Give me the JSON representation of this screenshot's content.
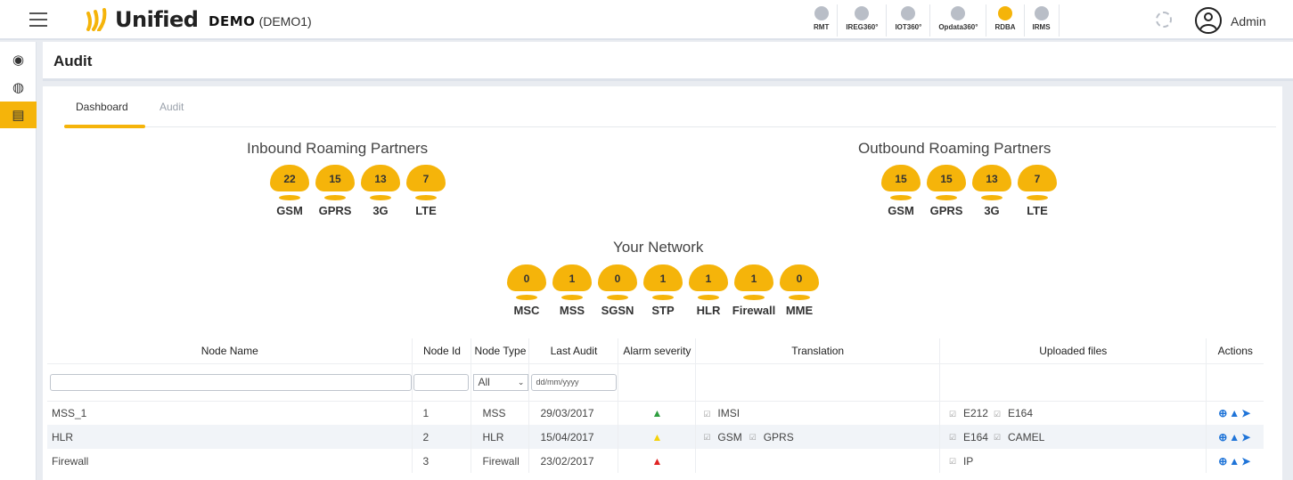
{
  "header": {
    "brand": "Unified",
    "demo_bold": "DEMO",
    "demo_code": "(DEMO1)",
    "apps": [
      {
        "label": "RMT",
        "active": false
      },
      {
        "label": "IREG360°",
        "active": false
      },
      {
        "label": "IOT360°",
        "active": false
      },
      {
        "label": "Opdata360°",
        "active": false
      },
      {
        "label": "RDBA",
        "active": true
      },
      {
        "label": "IRMS",
        "active": false
      }
    ],
    "user": "Admin"
  },
  "sidebar": {
    "items": [
      {
        "icon": "dashboard-icon",
        "glyph": "◉",
        "active": false
      },
      {
        "icon": "globe-icon",
        "glyph": "◍",
        "active": false
      },
      {
        "icon": "audit-report-icon",
        "glyph": "▤",
        "active": true
      }
    ]
  },
  "page": {
    "title": "Audit"
  },
  "tabs": [
    {
      "label": "Dashboard",
      "active": true
    },
    {
      "label": "Audit",
      "active": false
    }
  ],
  "inbound": {
    "title": "Inbound Roaming Partners",
    "items": [
      {
        "value": "22",
        "label": "GSM"
      },
      {
        "value": "15",
        "label": "GPRS"
      },
      {
        "value": "13",
        "label": "3G"
      },
      {
        "value": "7",
        "label": "LTE"
      }
    ]
  },
  "outbound": {
    "title": "Outbound Roaming Partners",
    "items": [
      {
        "value": "15",
        "label": "GSM"
      },
      {
        "value": "15",
        "label": "GPRS"
      },
      {
        "value": "13",
        "label": "3G"
      },
      {
        "value": "7",
        "label": "LTE"
      }
    ]
  },
  "network": {
    "title": "Your Network",
    "items": [
      {
        "value": "0",
        "label": "MSC"
      },
      {
        "value": "1",
        "label": "MSS"
      },
      {
        "value": "0",
        "label": "SGSN"
      },
      {
        "value": "1",
        "label": "STP"
      },
      {
        "value": "1",
        "label": "HLR"
      },
      {
        "value": "1",
        "label": "Firewall"
      },
      {
        "value": "0",
        "label": "MME"
      }
    ]
  },
  "table": {
    "columns": [
      "Node Name",
      "Node Id",
      "Node Type",
      "Last Audit",
      "Alarm severity",
      "Translation",
      "Uploaded files",
      "Actions"
    ],
    "filter": {
      "node_type_selected": "All",
      "date_placeholder": "dd/mm/yyyy"
    },
    "rows": [
      {
        "name": "MSS_1",
        "id": "1",
        "type": "MSS",
        "last_audit": "29/03/2017",
        "alarm_color": "#2e9e3f",
        "translation": [
          "IMSI"
        ],
        "files": [
          "E212",
          "E164"
        ]
      },
      {
        "name": "HLR",
        "id": "2",
        "type": "HLR",
        "last_audit": "15/04/2017",
        "alarm_color": "#f5d20a",
        "translation": [
          "GSM",
          "GPRS"
        ],
        "files": [
          "E164",
          "CAMEL"
        ]
      },
      {
        "name": "Firewall",
        "id": "3",
        "type": "Firewall",
        "last_audit": "23/02/2017",
        "alarm_color": "#e02424",
        "translation": [],
        "files": [
          "IP"
        ]
      }
    ]
  },
  "colors": {
    "accent": "#f5b40a",
    "action": "#1f74d8"
  }
}
